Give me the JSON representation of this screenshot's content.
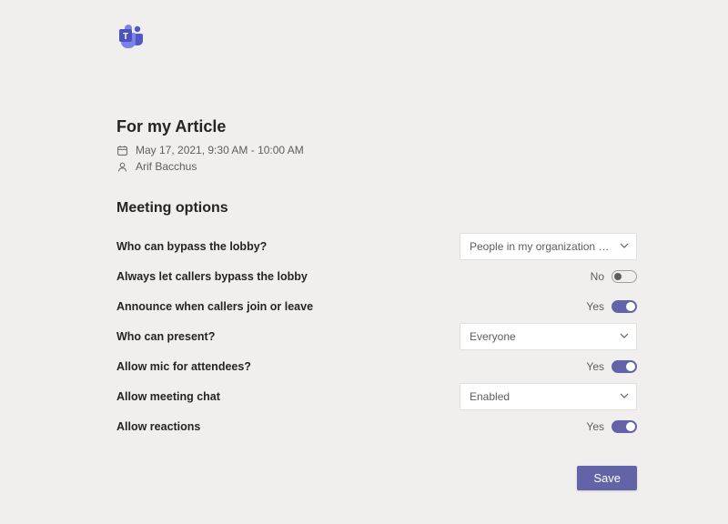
{
  "header": {
    "meeting_title": "For my Article",
    "datetime": "May 17, 2021, 9:30 AM - 10:00 AM",
    "organizer": "Arif Bacchus"
  },
  "section_title": "Meeting options",
  "options": {
    "bypass_lobby": {
      "label": "Who can bypass the lobby?",
      "value": "People in my organization and gu..."
    },
    "callers_bypass": {
      "label": "Always let callers bypass the lobby",
      "state_text": "No",
      "on": false
    },
    "announce": {
      "label": "Announce when callers join or leave",
      "state_text": "Yes",
      "on": true
    },
    "present": {
      "label": "Who can present?",
      "value": "Everyone"
    },
    "mic": {
      "label": "Allow mic for attendees?",
      "state_text": "Yes",
      "on": true
    },
    "chat": {
      "label": "Allow meeting chat",
      "value": "Enabled"
    },
    "reactions": {
      "label": "Allow reactions",
      "state_text": "Yes",
      "on": true
    }
  },
  "footer": {
    "save_label": "Save"
  },
  "colors": {
    "accent": "#6264a7"
  }
}
